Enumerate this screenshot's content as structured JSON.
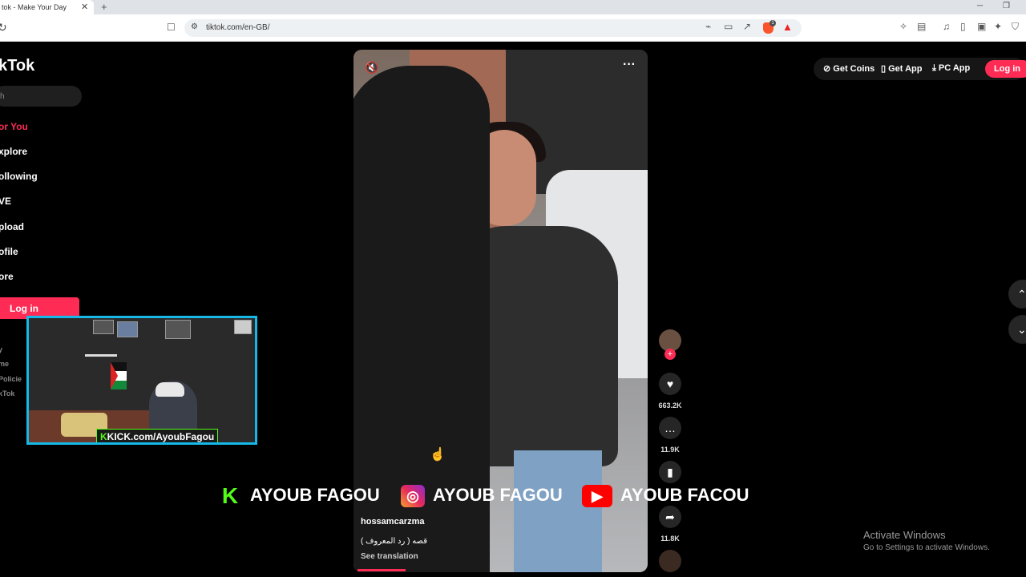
{
  "browser": {
    "tab_title": "tok - Make Your Day",
    "tab_close": "✕",
    "new_tab": "+",
    "url": "tiktok.com/en-GB/",
    "brave_badge": "1"
  },
  "sidebar": {
    "logo": "kTok",
    "search_placeholder": "h",
    "nav": [
      "or You",
      "xplore",
      "ollowing",
      "VE",
      "pload",
      "ofile",
      "ore"
    ],
    "login_label": "Log in",
    "footer_links": [
      "y",
      "me",
      "Policie",
      "kTok"
    ]
  },
  "header": {
    "get_coins": "Get Coins",
    "get_app": "Get App",
    "pc_app": "PC App",
    "login": "Log in"
  },
  "video": {
    "author": "hossamcarzma",
    "caption": "قصه ( رد المعروف )",
    "see_translation": "See translation"
  },
  "actions": {
    "likes": "663.2K",
    "comments": "11.9K",
    "shares": "11.8K"
  },
  "overlay": {
    "webcam_banner_k": "K",
    "webcam_banner": "KICK.com/AyoubFagou",
    "kick_name": "AYOUB FAGOU",
    "instagram_name": "AYOUB FAGOU",
    "youtube_name": "AYOUB FACOU"
  },
  "windows": {
    "activate_title": "Activate Windows",
    "activate_sub": "Go to Settings to activate Windows."
  },
  "colors": {
    "accent": "#fe2c55",
    "kick_green": "#53fc18",
    "webcam_border": "#16b8e8"
  }
}
